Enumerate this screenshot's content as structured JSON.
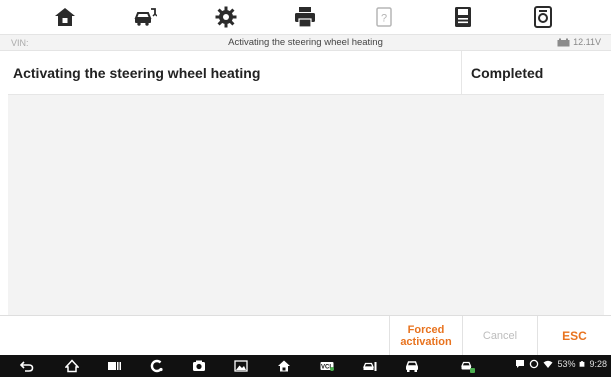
{
  "toolbar": {
    "icons": [
      "home-icon",
      "vehicle-swap-icon",
      "settings-gear-icon",
      "print-icon",
      "help-icon",
      "save-icon",
      "screenshot-icon"
    ]
  },
  "status_bar": {
    "vin_label": "VIN:",
    "title": "Activating the steering wheel heating",
    "voltage": "12.11V"
  },
  "table": {
    "row": {
      "name": "Activating the steering wheel heating",
      "status": "Completed"
    }
  },
  "actions": {
    "forced_line1": "Forced",
    "forced_line2": "activation",
    "cancel": "Cancel",
    "esc": "ESC"
  },
  "system_bar": {
    "battery_percent": "53%",
    "time": "9:28"
  },
  "colors": {
    "accent": "#e8731f",
    "toolbar_icon": "#2b2b2b",
    "disabled": "#bdbdbd",
    "system_bar": "#111111"
  }
}
